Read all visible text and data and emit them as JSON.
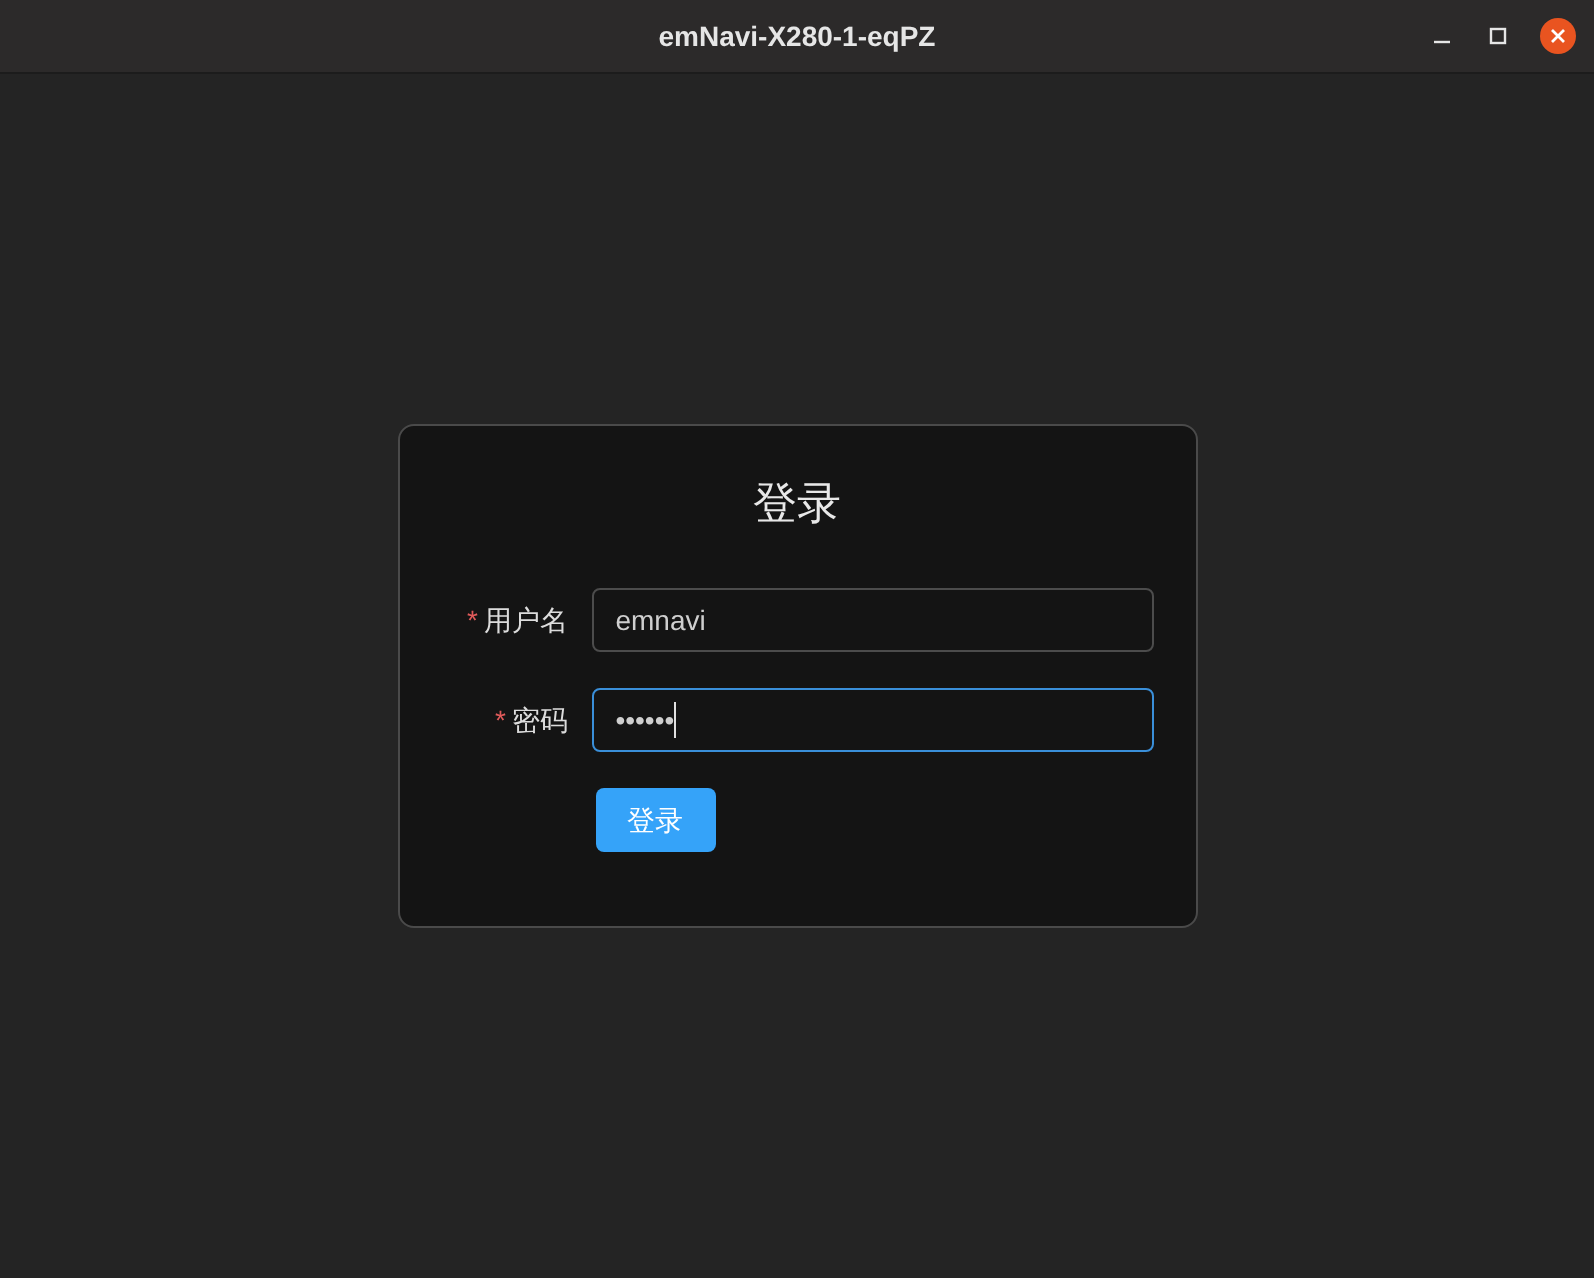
{
  "window": {
    "title": "emNavi-X280-1-eqPZ"
  },
  "login": {
    "title": "登录",
    "fields": [
      {
        "required_mark": "*",
        "label": "用户名",
        "value": "emnavi",
        "focused": false
      },
      {
        "required_mark": "*",
        "label": "密码",
        "value": "••••••",
        "focused": true
      }
    ],
    "button": "登录"
  }
}
